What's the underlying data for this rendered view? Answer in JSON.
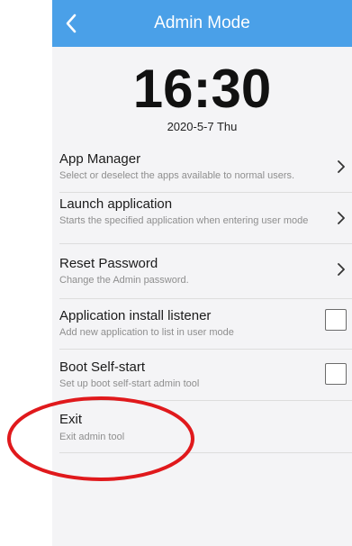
{
  "appbar": {
    "title": "Admin Mode"
  },
  "clock": {
    "time": "16:30",
    "date": "2020-5-7 Thu"
  },
  "settings": {
    "app_manager": {
      "title": "App Manager",
      "subtitle": "Select or deselect the apps available to normal users."
    },
    "launch_application": {
      "title": "Launch application",
      "subtitle": "Starts the specified application when entering user mode"
    },
    "reset_password": {
      "title": "Reset Password",
      "subtitle": "Change the Admin password."
    },
    "install_listener": {
      "title": "Application install listener",
      "subtitle": "Add new application to list in user mode",
      "checked": false
    },
    "boot_self_start": {
      "title": "Boot Self-start",
      "subtitle": "Set up boot self-start admin tool",
      "checked": false
    },
    "exit": {
      "title": "Exit",
      "subtitle": "Exit admin tool"
    }
  },
  "colors": {
    "appbar": "#4aa0e8",
    "background": "#f4f4f6",
    "annotation": "#e0191c"
  },
  "icons": {
    "back": "chevron-left-icon",
    "row_arrow": "chevron-right-icon"
  }
}
